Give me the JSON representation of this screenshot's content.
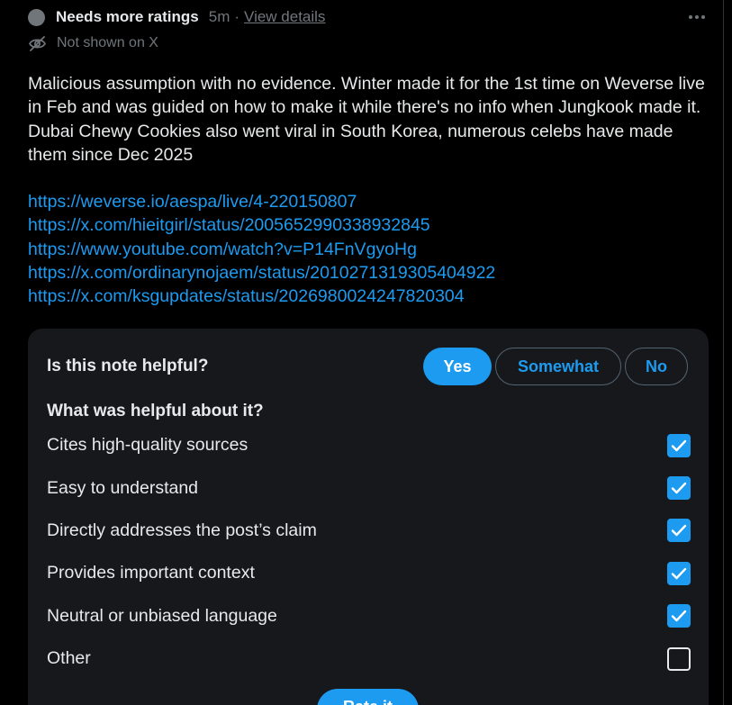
{
  "header": {
    "status_title": "Needs more ratings",
    "timeago": "5m",
    "separator": "·",
    "view_details": "View details",
    "more_icon": "more-horizontal-icon"
  },
  "subheader": {
    "icon": "eye-off-icon",
    "text": "Not shown on X"
  },
  "note": {
    "body": "Malicious assumption with no evidence. Winter made it for the 1st time on Weverse live in Feb and was guided on how to make it while there's no info when Jungkook made it. Dubai Chewy Cookies also went viral in South Korea, numerous celebs have made them since Dec 2025",
    "links": [
      "https://weverse.io/aespa/live/4-220150807",
      "https://x.com/hieitgirl/status/2005652990338932845",
      "https://www.youtube.com/watch?v=P14FnVgyoHg",
      "https://x.com/ordinarynojaem/status/2010271319305404922",
      "https://x.com/ksgupdates/status/2026980024247820304"
    ]
  },
  "rating": {
    "question": "Is this note helpful?",
    "buttons": {
      "yes": "Yes",
      "somewhat": "Somewhat",
      "no": "No"
    },
    "selected": "Yes",
    "helpful_question": "What was helpful about it?",
    "options": [
      {
        "label": "Cites high-quality sources",
        "checked": true
      },
      {
        "label": "Easy to understand",
        "checked": true
      },
      {
        "label": "Directly addresses the post’s claim",
        "checked": true
      },
      {
        "label": "Provides important context",
        "checked": true
      },
      {
        "label": "Neutral or unbiased language",
        "checked": true
      },
      {
        "label": "Other",
        "checked": false
      }
    ],
    "submit_label": "Rate it"
  },
  "colors": {
    "accent": "#1d9bf0",
    "background": "#000000",
    "card": "#16181c",
    "muted_text": "#71767b"
  }
}
